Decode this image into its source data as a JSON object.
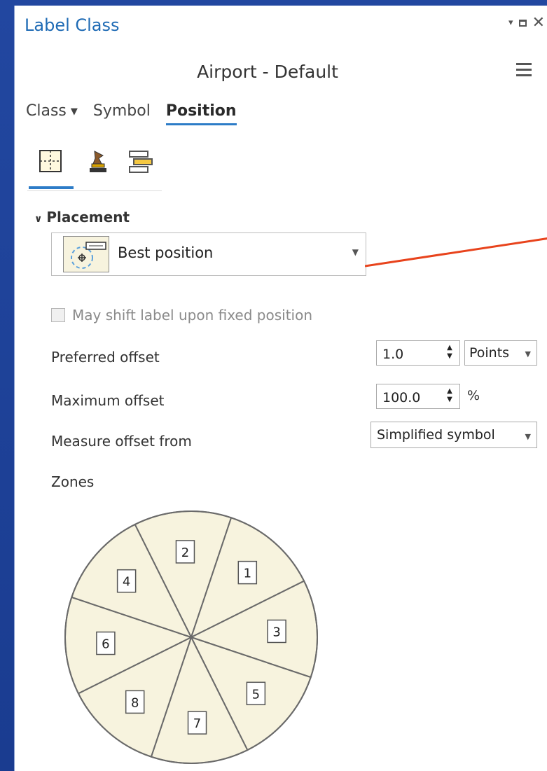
{
  "window": {
    "title": "Label Class",
    "controls": [
      "chevron-down-icon",
      "maximize-icon",
      "close-icon"
    ]
  },
  "header": {
    "subtitle": "Airport - Default"
  },
  "tabs": [
    {
      "label": "Class",
      "has_dropdown": true,
      "active": false
    },
    {
      "label": "Symbol",
      "active": false
    },
    {
      "label": "Position",
      "active": true
    }
  ],
  "subtabs": [
    {
      "icon": "placement-icon",
      "active": true
    },
    {
      "icon": "conflict-resolution-icon",
      "active": false
    },
    {
      "icon": "fitting-strategy-icon",
      "active": false
    }
  ],
  "placement": {
    "section_label": "Placement",
    "dropdown_value": "Best position",
    "shift_label_checkbox": {
      "label": "May shift label upon fixed position",
      "checked": false,
      "enabled": false
    },
    "preferred_offset": {
      "label": "Preferred offset",
      "value": "1.0",
      "unit": "Points"
    },
    "maximum_offset": {
      "label": "Maximum offset",
      "value": "100.0",
      "unit": "%"
    },
    "measure_offset_from": {
      "label": "Measure offset from",
      "value": "Simplified symbol"
    },
    "zones_label": "Zones"
  },
  "zones": [
    "2",
    "1",
    "3",
    "5",
    "7",
    "8",
    "6",
    "4"
  ],
  "colors": {
    "accent": "#2d7cc7",
    "title": "#1f6bb5",
    "zone_fill": "#f7f3de",
    "annotation_line": "#e8431c",
    "frame_bg": "#1b3f92"
  }
}
